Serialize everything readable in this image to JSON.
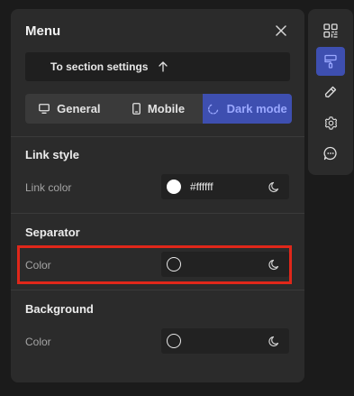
{
  "panel": {
    "title": "Menu",
    "section_link_label": "To section settings"
  },
  "tabs": [
    {
      "label": "General",
      "icon": "monitor-icon",
      "active": false
    },
    {
      "label": "Mobile",
      "icon": "phone-icon",
      "active": false
    },
    {
      "label": "Dark mode",
      "icon": "dark-mode-icon",
      "active": true
    }
  ],
  "sections": {
    "link_style": {
      "title": "Link style",
      "row_label": "Link color",
      "value": "#ffffff"
    },
    "separator": {
      "title": "Separator",
      "row_label": "Color",
      "value": ""
    },
    "background": {
      "title": "Background",
      "row_label": "Color",
      "value": ""
    }
  },
  "toolbar": {
    "items": [
      {
        "icon": "qr-grid-icon",
        "active": false
      },
      {
        "icon": "paint-roller-icon",
        "active": true
      },
      {
        "icon": "pencil-icon",
        "active": false
      },
      {
        "icon": "gear-icon",
        "active": false
      },
      {
        "icon": "chat-bubble-icon",
        "active": false
      }
    ]
  },
  "colors": {
    "accent": "#3e4fb0",
    "accent_text": "#9aa8ff",
    "highlight": "#e0271a",
    "panel_bg": "#2b2b2b"
  }
}
